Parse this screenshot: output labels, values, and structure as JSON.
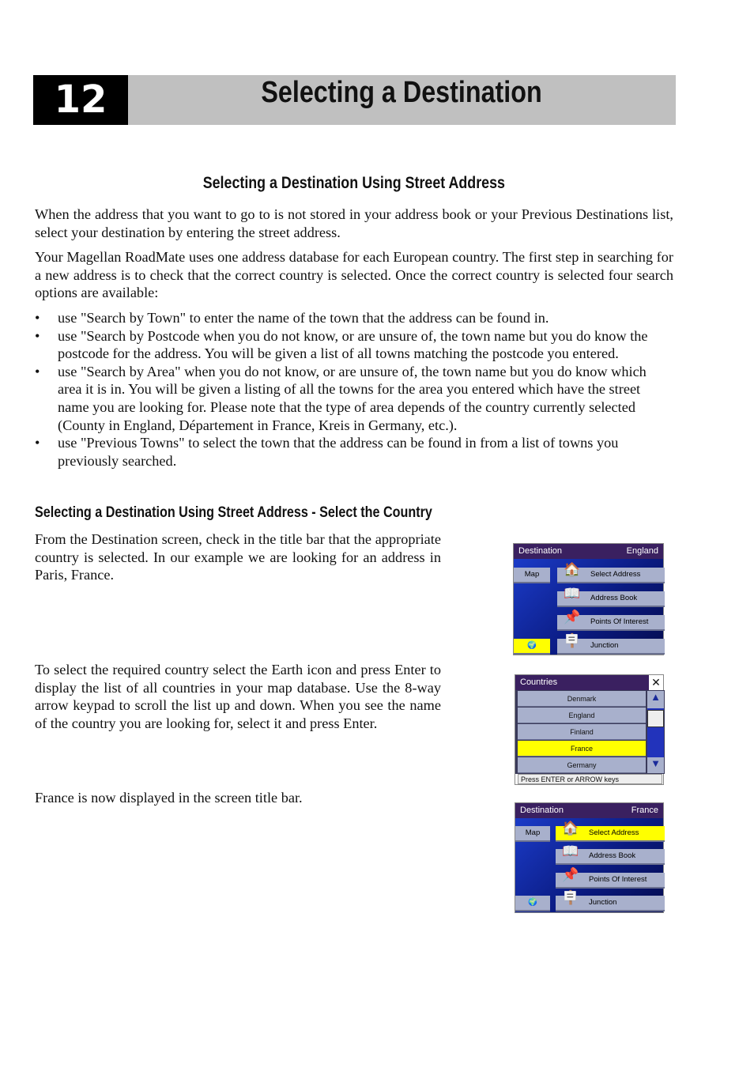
{
  "chapter": {
    "number": "12",
    "title": "Selecting a Destination"
  },
  "section1": {
    "heading": "Selecting a Destination Using Street Address",
    "p1": "When the address that you want to go to is not stored in your address book or your Previous Destinations list, select your destination by entering the street address.",
    "p2": "Your Magellan RoadMate uses one address database for each European country. The first step in searching for a new address is to check that the correct country is selected. Once the correct country is selected four search options are available:",
    "bullets": [
      "use \"Search by Town\" to enter the name of the town that the address can be found in.",
      "use \"Search by Postcode when you do not know, or are unsure of, the town name but you do know the postcode for the address. You will be given a list of all towns matching the postcode you entered.",
      "use \"Search by Area\" when you do not know, or are unsure of, the town name but you do  know which area it is in. You will be given a listing of all the towns for the area you entered which have the street name you are looking for. Please note that the type of area depends of the country currently selected (County in England, Département in France, Kreis in Germany, etc.).",
      "use \"Previous Towns\" to select the town that the address can be found in from a list of towns you previously searched."
    ]
  },
  "section2": {
    "heading": "Selecting a Destination Using Street Address - Select the Country",
    "p1": "From the Destination screen, check in the title bar that the appropriate country is selected. In our example we are looking for an address in Paris, France.",
    "p2": "To select the required country select the Earth icon and press Enter to display the list of all countries in your map database. Use the 8-way arrow keypad to scroll the list up and down. When you see the name of the country you are looking for, select it and press Enter.",
    "p3": "France is now displayed in the screen title bar."
  },
  "screen1": {
    "title": "Destination",
    "country": "England",
    "map": "Map",
    "items": [
      "Select Address",
      "Address Book",
      "Points Of Interest",
      "Junction"
    ]
  },
  "screen2": {
    "title": "Countries",
    "close": "✕",
    "countries": [
      "Denmark",
      "England",
      "Finland",
      "France",
      "Germany"
    ],
    "selected": "France",
    "hint": "Press ENTER or ARROW keys"
  },
  "screen3": {
    "title": "Destination",
    "country": "France",
    "map": "Map",
    "items": [
      "Select Address",
      "Address Book",
      "Points Of Interest",
      "Junction"
    ]
  },
  "colors": {
    "highlight": "#ffff00",
    "title_bar": "#3a2060",
    "screen_bg": "#1d3fd0"
  }
}
